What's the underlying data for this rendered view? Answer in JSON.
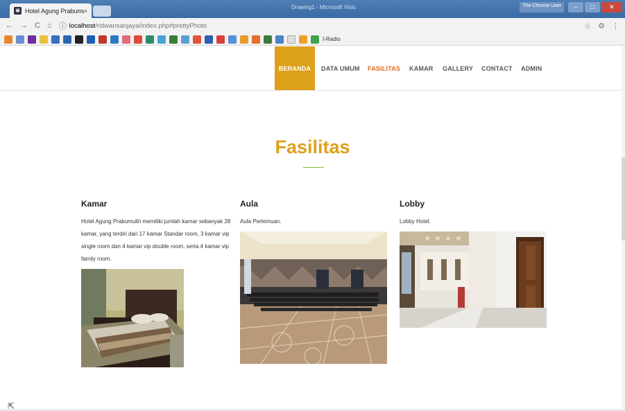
{
  "browser": {
    "tab_title": "Hotel Agung Prabumulih",
    "tab_close": "×",
    "window_title": "Drawing1 - Microsoft Visio",
    "user_badge": "The Chrome User",
    "url_host": "localhost",
    "url_path": "/ridwansanjaya/index.php#prettyPhoto",
    "bookmark_label": "I-Radio"
  },
  "nav": {
    "items": [
      {
        "label": "BERANDA"
      },
      {
        "label": "DATA UMUM"
      },
      {
        "label": "FASILITAS"
      },
      {
        "label": "KAMAR"
      },
      {
        "label": "GALLERY"
      },
      {
        "label": "CONTACT"
      },
      {
        "label": "ADMIN"
      }
    ]
  },
  "section": {
    "title": "Fasilitas"
  },
  "facilities": [
    {
      "heading": "Kamar",
      "description": "Hotel Agung Prabumulih memiliki jumlah kamar sebanyak 28 kamar, yang terdiri dari 17 kamar Standar room, 3 kamar vip single room dan 4 kamar vip double room, serta 4 kamar vip family room.",
      "image": "bedroom-photo"
    },
    {
      "heading": "Aula",
      "description": "Aula Pertemuan.",
      "image": "hall-photo"
    },
    {
      "heading": "Lobby",
      "description": "Lobby Hotel.",
      "image": "lobby-photo"
    }
  ],
  "colors": {
    "accent": "#dda019",
    "current_nav": "#e0691b"
  }
}
